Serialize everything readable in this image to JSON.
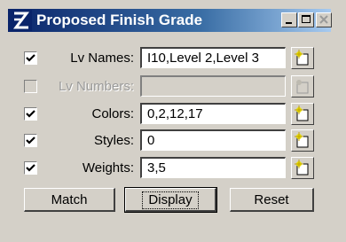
{
  "window": {
    "title": "Proposed Finish Grade"
  },
  "fields": [
    {
      "key": "lv_names",
      "label": "Lv Names:",
      "value": "I10,Level 2,Level 3",
      "checked": true,
      "enabled": true
    },
    {
      "key": "lv_numbers",
      "label": "Lv Numbers:",
      "value": "",
      "checked": false,
      "enabled": false
    },
    {
      "key": "colors",
      "label": "Colors:",
      "value": "0,2,12,17",
      "checked": true,
      "enabled": true
    },
    {
      "key": "styles",
      "label": "Styles:",
      "value": "0",
      "checked": true,
      "enabled": true
    },
    {
      "key": "weights",
      "label": "Weights:",
      "value": "3,5",
      "checked": true,
      "enabled": true
    }
  ],
  "buttons": {
    "match": "Match",
    "display": "Display",
    "reset": "Reset"
  },
  "colors": {
    "title_bar_start": "#0a246a",
    "title_bar_end": "#a6caf0",
    "dialog_bg": "#d4d0c8"
  },
  "icons": {
    "app": "microstation-logo-icon",
    "pick": "pick-element-icon"
  }
}
